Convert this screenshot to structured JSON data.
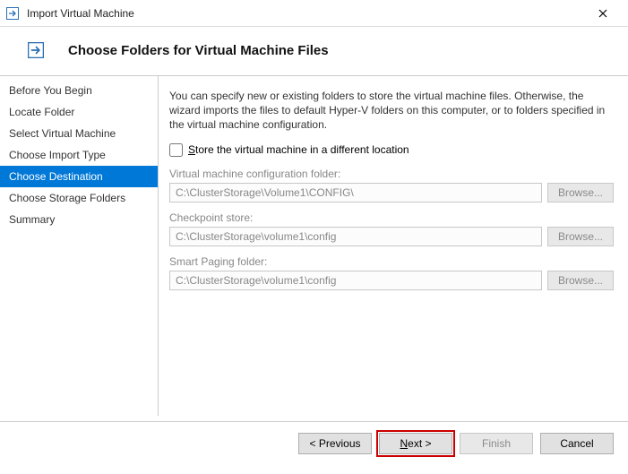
{
  "window": {
    "title": "Import Virtual Machine"
  },
  "header": {
    "title": "Choose Folders for Virtual Machine Files"
  },
  "sidebar": {
    "items": [
      {
        "label": "Before You Begin"
      },
      {
        "label": "Locate Folder"
      },
      {
        "label": "Select Virtual Machine"
      },
      {
        "label": "Choose Import Type"
      },
      {
        "label": "Choose Destination"
      },
      {
        "label": "Choose Storage Folders"
      },
      {
        "label": "Summary"
      }
    ],
    "selected_index": 4
  },
  "main": {
    "description": "You can specify new or existing folders to store the virtual machine files. Otherwise, the wizard imports the files to default Hyper-V folders on this computer, or to folders specified in the virtual machine configuration.",
    "checkbox_label": "Store the virtual machine in a different location",
    "checkbox_checked": false,
    "fields": [
      {
        "label": "Virtual machine configuration folder:",
        "value": "C:\\ClusterStorage\\Volume1\\CONFIG\\",
        "browse": "Browse..."
      },
      {
        "label": "Checkpoint store:",
        "value": "C:\\ClusterStorage\\volume1\\config",
        "browse": "Browse..."
      },
      {
        "label": "Smart Paging folder:",
        "value": "C:\\ClusterStorage\\volume1\\config",
        "browse": "Browse..."
      }
    ]
  },
  "footer": {
    "previous": "< Previous",
    "next": "Next >",
    "finish": "Finish",
    "cancel": "Cancel"
  },
  "icons": {
    "app": "arrow-right-icon",
    "close": "close-icon"
  }
}
